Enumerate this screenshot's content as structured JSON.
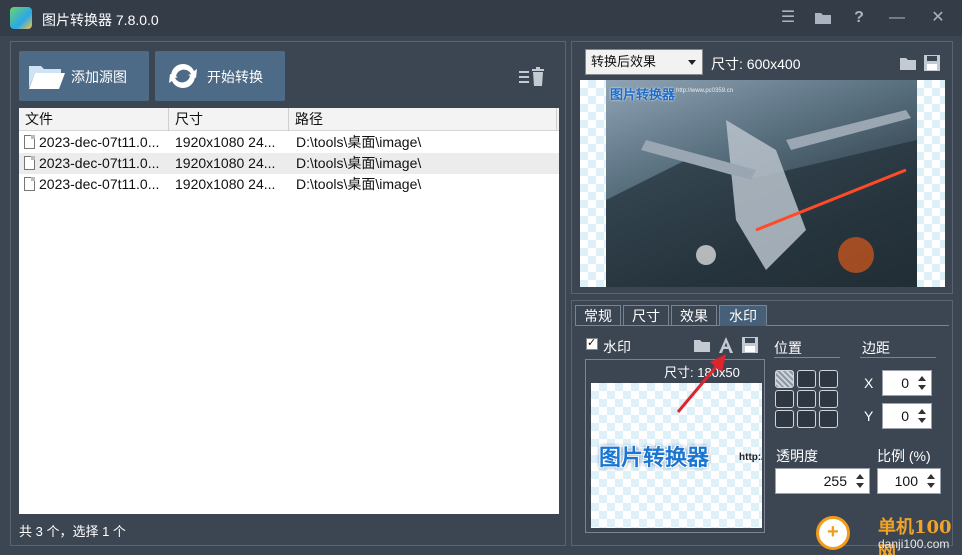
{
  "window": {
    "title": "图片转换器 7.8.0.0",
    "controls": [
      "menu-icon",
      "folder-icon",
      "help-icon",
      "minimize-icon",
      "close-icon"
    ],
    "help_glyph": "?",
    "minimize_glyph": "—",
    "close_glyph": "✕",
    "menu_glyph": "☰"
  },
  "toolbar": {
    "add_source_label": "添加源图",
    "start_convert_label": "开始转换"
  },
  "file_list": {
    "columns": [
      "文件",
      "尺寸",
      "路径"
    ],
    "rows": [
      {
        "name": "2023-dec-07t11.0...",
        "size": "1920x1080  24...",
        "path": "D:\\tools\\桌面\\image\\",
        "selected": false
      },
      {
        "name": "2023-dec-07t11.0...",
        "size": "1920x1080  24...",
        "path": "D:\\tools\\桌面\\image\\",
        "selected": true
      },
      {
        "name": "2023-dec-07t11.0...",
        "size": "1920x1080  24...",
        "path": "D:\\tools\\桌面\\image\\",
        "selected": false
      }
    ]
  },
  "status": {
    "text": "共 3 个，选择 1 个"
  },
  "preview": {
    "mode_selected": "转换后效果",
    "size_text": "尺寸: 600x400",
    "watermark_text": "图片转换器",
    "watermark_url": "http://www.pc0359.cn"
  },
  "tabs": [
    {
      "label": "常规",
      "active": false
    },
    {
      "label": "尺寸",
      "active": false
    },
    {
      "label": "效果",
      "active": false
    },
    {
      "label": "水印",
      "active": true
    }
  ],
  "watermark_tab": {
    "enable_label": "水印",
    "enabled": true,
    "size_text": "尺寸: 180x50",
    "wm_text": "图片转换器",
    "wm_url": "http:/",
    "position_label": "位置",
    "margin_label": "边距",
    "x_label": "X",
    "y_label": "Y",
    "x_value": "0",
    "y_value": "0",
    "opacity_label": "透明度",
    "opacity_value": "255",
    "scale_label": "比例 (%)",
    "scale_value": "100",
    "position_selected": "top-left"
  },
  "branding": {
    "title": "单机100网",
    "url": "danji100.com"
  },
  "colors": {
    "background": "#3c4552",
    "button": "#4d6a86",
    "accent_blue": "#1976d2",
    "arrow_red": "#e0242b",
    "brand_orange": "#f29b1b"
  }
}
